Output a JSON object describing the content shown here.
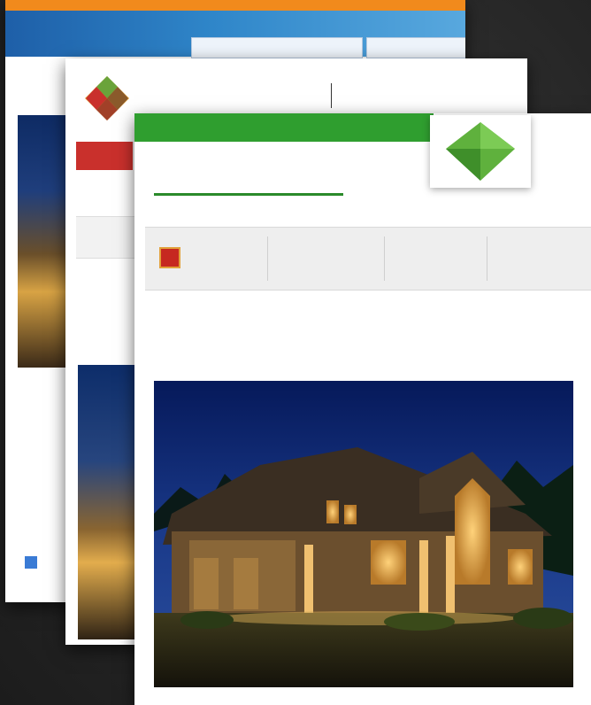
{
  "back_page": {
    "top_bar_text": "",
    "side_text": "",
    "tabs": [
      "",
      ""
    ]
  },
  "middle_page": {
    "title": "",
    "subtitle": "",
    "red_button_label": "",
    "nav_item": "",
    "row1_text": "",
    "row2_text": ""
  },
  "front_page": {
    "green_bar_text": "",
    "brand": "",
    "tagline": "",
    "badge_link": "",
    "nav_items": [
      "",
      "",
      "",
      ""
    ],
    "breadcrumb": "",
    "headline": ""
  },
  "colors": {
    "green": "#2f9e2f",
    "red": "#c9302c",
    "orange": "#f18a1c",
    "blue": "#1e5fa8",
    "background": "#262626"
  }
}
